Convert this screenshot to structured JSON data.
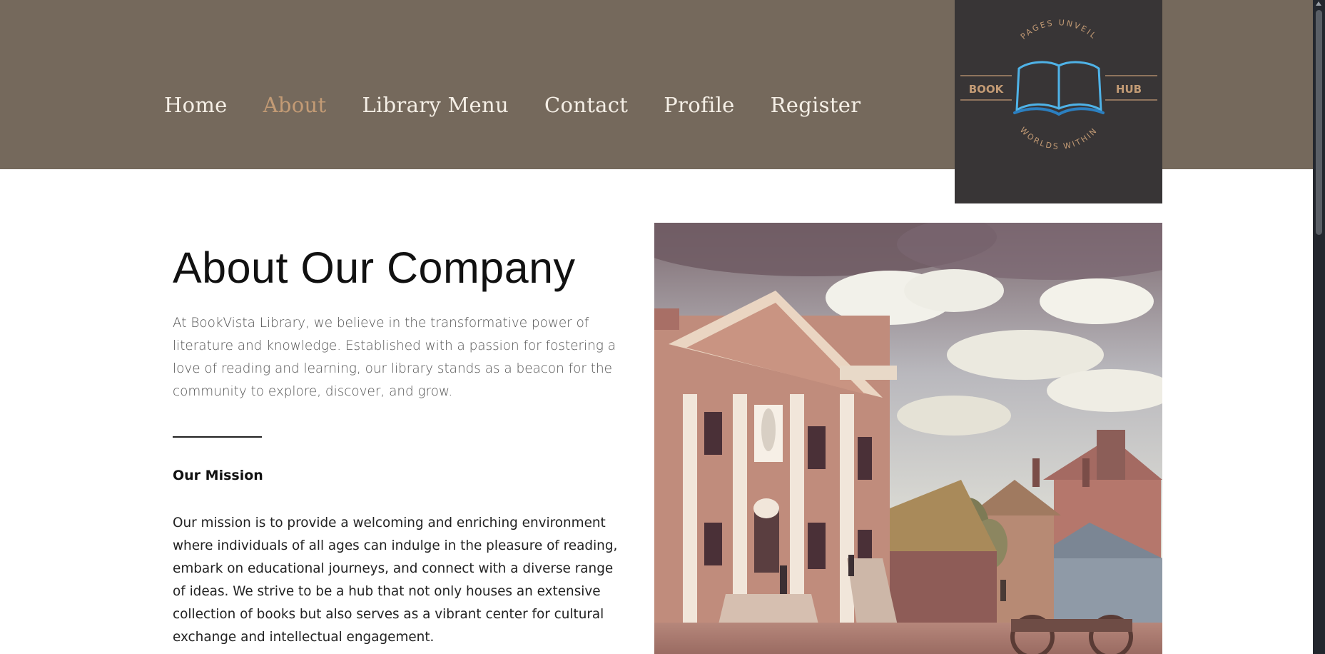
{
  "nav": {
    "items": [
      {
        "label": "Home",
        "active": false
      },
      {
        "label": "About",
        "active": true
      },
      {
        "label": "Library Menu",
        "active": false
      },
      {
        "label": "Contact",
        "active": false
      },
      {
        "label": "Profile",
        "active": false
      },
      {
        "label": "Register",
        "active": false
      }
    ]
  },
  "logo": {
    "top_text": "PAGES UNVEIL",
    "left_text": "BOOK",
    "right_text": "HUB",
    "bottom_text": "WORLDS WITHIN"
  },
  "about": {
    "title": "About Our Company",
    "intro": "At BookVista Library, we believe in the transformative power of literature and knowledge. Established with a passion for fostering a love of reading and learning, our library stands as a beacon for the community to explore, discover, and grow.",
    "mission_title": "Our Mission",
    "mission_text": "Our mission is to provide a welcoming and enriching environment where individuals of all ages can indulge in the pleasure of reading, embark on educational journeys, and connect with a diverse range of ideas. We strive to be a hub that not only houses an extensive collection of books but also serves as a vibrant center for cultural exchange and intellectual engagement."
  },
  "colors": {
    "header_bg": "#75695c",
    "nav_text": "#f5efe6",
    "nav_active": "#c39b75",
    "logo_bg": "#383536",
    "logo_accent": "#4fb3e8",
    "logo_gold": "#c39b75"
  },
  "icons": {
    "logo": "open-book-icon",
    "hero_image": "historic-library-building-illustration"
  }
}
